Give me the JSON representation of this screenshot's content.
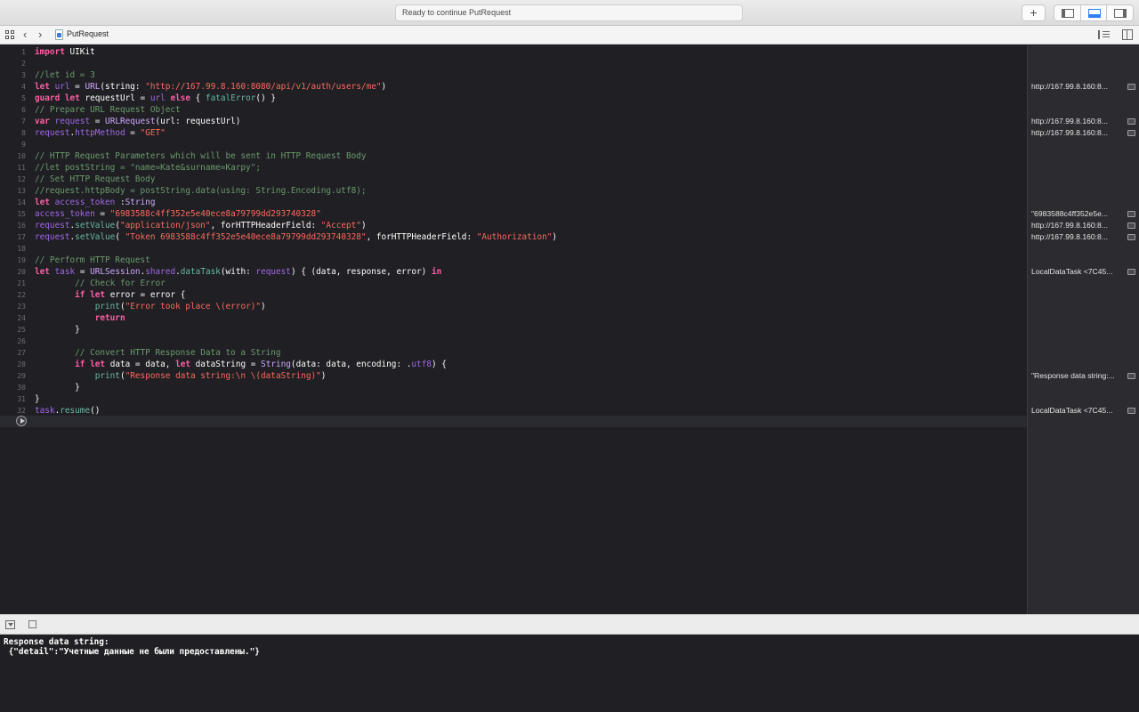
{
  "toolbar": {
    "status": "Ready to continue PutRequest",
    "add_label": "+",
    "icons": [
      "add-icon",
      "navigator-toggle-icon",
      "debug-area-toggle-icon",
      "utilities-toggle-icon"
    ]
  },
  "jumpbar": {
    "back": "‹",
    "forward": "›",
    "file_name": "PutRequest"
  },
  "editor": {
    "line_numbers": [
      "1",
      "2",
      "3",
      "4",
      "5",
      "6",
      "7",
      "8",
      "9",
      "10",
      "11",
      "12",
      "13",
      "14",
      "15",
      "16",
      "17",
      "18",
      "19",
      "20",
      "21",
      "22",
      "23",
      "24",
      "25",
      "26",
      "27",
      "28",
      "29",
      "30",
      "31",
      "32"
    ],
    "syntax_colors": {
      "keyword": "#fc5fa3",
      "string": "#fc6a5d",
      "comment": "#6c9b6c",
      "background": "#1f1f24"
    },
    "lines": {
      "l1": {
        "kw": "import",
        "t": " UIKit"
      },
      "l3": {
        "cmt": "//let id = 3"
      },
      "l4": {
        "kw": "let",
        "sp": " ",
        "prop": "url",
        "t": " = ",
        "ty": "URL",
        "t2": "(string: ",
        "str": "\"http://167.99.8.160:8080/api/v1/auth/users/me\"",
        "t3": ")"
      },
      "l5": {
        "kw": "guard",
        "sp": " ",
        "kw2": "let",
        "t": " requestUrl = ",
        "prop": "url",
        "sp2": " ",
        "kw3": "else",
        "t2": " { ",
        "fn": "fatalError",
        "t3": "() }"
      },
      "l6": {
        "cmt": "// Prepare URL Request Object"
      },
      "l7": {
        "kw": "var",
        "sp": " ",
        "prop": "request",
        "t": " = ",
        "ty": "URLRequest",
        "t2": "(url: requestUrl)"
      },
      "l8": {
        "prop": "request",
        "t": ".",
        "prop2": "httpMethod",
        "t2": " = ",
        "str": "\"GET\""
      },
      "l10": {
        "cmt": "// HTTP Request Parameters which will be sent in HTTP Request Body"
      },
      "l11": {
        "cmt": "//let postString = \"name=Kate&surname=Karpy\";"
      },
      "l12": {
        "cmt": "// Set HTTP Request Body"
      },
      "l13": {
        "cmt": "//request.httpBody = postString.data(using: String.Encoding.utf8);"
      },
      "l14": {
        "kw": "let",
        "sp": " ",
        "prop": "access_token",
        "t": " :",
        "ty": "String"
      },
      "l15": {
        "prop": "access_token",
        "t": " = ",
        "str": "\"6983588c4ff352e5e40ece8a79799dd293740328\""
      },
      "l16": {
        "prop": "request",
        "t": ".",
        "fn": "setValue",
        "t2": "(",
        "str": "\"application/json\"",
        "t3": ", forHTTPHeaderField: ",
        "str2": "\"Accept\"",
        "t4": ")"
      },
      "l17": {
        "prop": "request",
        "t": ".",
        "fn": "setValue",
        "t2": "( ",
        "str": "\"Token 6983588c4ff352e5e40ece8a79799dd293740328\"",
        "t3": ", forHTTPHeaderField: ",
        "str2": "\"Authorization\"",
        "t4": ")"
      },
      "l19": {
        "cmt": "// Perform HTTP Request"
      },
      "l20": {
        "kw": "let",
        "sp": " ",
        "prop": "task",
        "t": " = ",
        "ty": "URLSession",
        "t2": ".",
        "prop2": "shared",
        "t3": ".",
        "fn": "dataTask",
        "t4": "(with: ",
        "prop3": "request",
        "t5": ") { (data, response, error) ",
        "kw2": "in"
      },
      "l21": {
        "ind": "        ",
        "cmt": "// Check for Error"
      },
      "l22": {
        "ind": "        ",
        "kw": "if",
        "sp": " ",
        "kw2": "let",
        "t": " error = error {"
      },
      "l23": {
        "ind": "            ",
        "fn": "print",
        "t": "(",
        "str": "\"Error took place \\(error)\"",
        "t2": ")"
      },
      "l24": {
        "ind": "            ",
        "kw": "return"
      },
      "l25": {
        "ind": "        ",
        "t": "}"
      },
      "l27": {
        "ind": "        ",
        "cmt": "// Convert HTTP Response Data to a String"
      },
      "l28": {
        "ind": "        ",
        "kw": "if",
        "sp": " ",
        "kw2": "let",
        "t": " data = data, ",
        "kw3": "let",
        "t2": " dataString = ",
        "ty": "String",
        "t3": "(data: data, encoding: .",
        "prop": "utf8",
        "t4": ") {"
      },
      "l29": {
        "ind": "            ",
        "fn": "print",
        "t": "(",
        "str": "\"Response data string:\\n \\(dataString)\"",
        "t2": ")"
      },
      "l30": {
        "ind": "        ",
        "t": "}"
      },
      "l31": {
        "t": "}"
      },
      "l32": {
        "prop": "task",
        "t": ".",
        "fn": "resume",
        "t2": "()"
      }
    }
  },
  "results": [
    {
      "line": 4,
      "text": "http://167.99.8.160:8..."
    },
    {
      "line": 7,
      "text": "http://167.99.8.160:8..."
    },
    {
      "line": 8,
      "text": "http://167.99.8.160:8..."
    },
    {
      "line": 15,
      "text": "\"6983588c4ff352e5e..."
    },
    {
      "line": 16,
      "text": "http://167.99.8.160:8..."
    },
    {
      "line": 17,
      "text": "http://167.99.8.160:8..."
    },
    {
      "line": 20,
      "text": "LocalDataTask <7C45..."
    },
    {
      "line": 29,
      "text": "\"Response data string:..."
    },
    {
      "line": 32,
      "text": "LocalDataTask <7C45..."
    }
  ],
  "console": {
    "lines": [
      "Response data string:",
      " {\"detail\":\"Учетные данные не были предоставлены.\"}"
    ]
  }
}
